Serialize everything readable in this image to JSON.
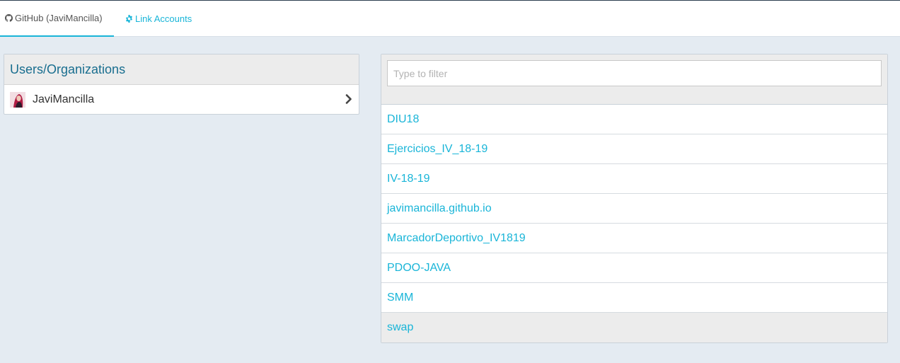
{
  "tabs": {
    "github_label": "GitHub (JaviMancilla)",
    "link_accounts_label": "Link Accounts",
    "github_icon": "github-icon",
    "link_icon": "gear-icon"
  },
  "users_panel": {
    "heading": "Users/Organizations",
    "users": [
      {
        "name": "JaviMancilla",
        "icon": "chevron-right-icon"
      }
    ]
  },
  "repos_panel": {
    "filter_placeholder": "Type to filter",
    "filter_value": "",
    "repos": [
      {
        "name": "DIU18"
      },
      {
        "name": "Ejercicios_IV_18-19"
      },
      {
        "name": "IV-18-19"
      },
      {
        "name": "javimancilla.github.io"
      },
      {
        "name": "MarcadorDeportivo_IV1819"
      },
      {
        "name": "PDOO-JAVA"
      },
      {
        "name": "SMM"
      },
      {
        "name": "swap",
        "selected": true
      }
    ]
  },
  "colors": {
    "accent": "#19b5d8",
    "heading_text": "#196e8f",
    "page_bg": "#e4ebf2",
    "panel_header_bg": "#ececec"
  }
}
